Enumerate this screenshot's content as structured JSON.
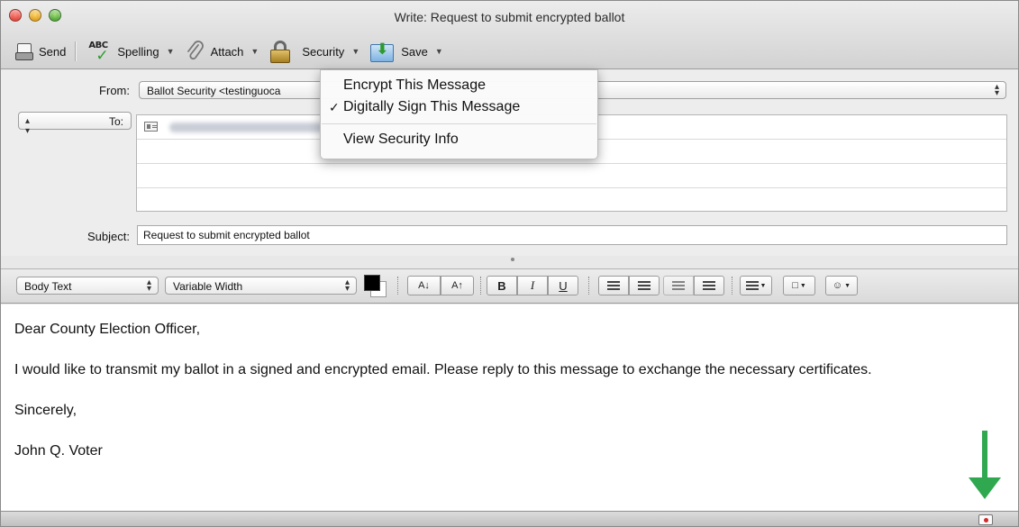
{
  "window": {
    "title": "Write: Request to submit encrypted ballot"
  },
  "toolbar": {
    "send_label": "Send",
    "spelling_label": "Spelling",
    "attach_label": "Attach",
    "security_label": "Security",
    "save_label": "Save",
    "spelling_icon_text": "ABC"
  },
  "header": {
    "from_label": "From:",
    "from_value": "Ballot Security <testinguoca",
    "to_label": "To:",
    "subject_label": "Subject:",
    "subject_value": "Request to submit encrypted ballot"
  },
  "format_bar": {
    "style_value": "Body Text",
    "font_value": "Variable Width",
    "decrease_size_label": "A↓",
    "increase_size_label": "A↑",
    "bold_label": "B",
    "italic_label": "I",
    "underline_label": "U"
  },
  "body": {
    "greeting": "Dear County Election Officer,",
    "paragraph": "I would like to transmit my ballot in a signed and encrypted email. Please reply to this message to exchange the necessary certificates.",
    "closing": "Sincerely,",
    "signature": "John Q. Voter"
  },
  "security_menu": {
    "items": [
      {
        "label": "Encrypt This Message",
        "checked": false
      },
      {
        "label": "Digitally Sign This Message",
        "checked": true
      },
      {
        "label": "View Security Info",
        "checked": false
      }
    ]
  },
  "colors": {
    "annotation_arrow": "#2fa84f",
    "text_color_well": "#000000"
  }
}
